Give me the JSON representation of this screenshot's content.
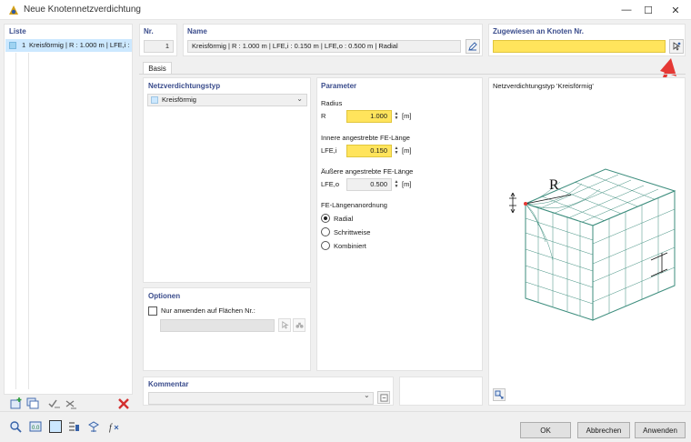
{
  "window": {
    "title": "Neue Knotennetzverdichtung",
    "minimize_icon": "minimize-icon",
    "maximize_icon": "maximize-icon",
    "close_icon": "close-icon"
  },
  "list": {
    "header": "Liste",
    "items": [
      {
        "number": "1",
        "label": "Kreisförmig | R : 1.000 m | LFE,i : 0.1"
      }
    ],
    "toolbar_icons": [
      "new-icon",
      "copy-icon",
      "check-all-icon",
      "uncheck-all-icon",
      "delete-icon"
    ]
  },
  "number": {
    "label": "Nr.",
    "value": "1"
  },
  "name": {
    "label": "Name",
    "value": "Kreisförmig | R : 1.000 m | LFE,i : 0.150 m | LFE,o : 0.500 m | Radial",
    "edit_icon": "edit-icon"
  },
  "assigned": {
    "label": "Zugewiesen an Knoten Nr.",
    "value": "",
    "pick_icon": "pick-node-icon"
  },
  "tabs": [
    {
      "label": "Basis"
    }
  ],
  "type": {
    "header": "Netzverdichtungstyp",
    "selected": "Kreisförmig"
  },
  "options": {
    "header": "Optionen",
    "apply_label": "Nur anwenden auf Flächen Nr.:",
    "apply_checked": false
  },
  "params": {
    "header": "Parameter",
    "radius": {
      "title": "Radius",
      "symbol": "R",
      "value": "1.000",
      "unit": "[m]"
    },
    "inner": {
      "title": "Innere angestrebte FE-Länge",
      "symbol": "LFE,i",
      "value": "0.150",
      "unit": "[m]"
    },
    "outer": {
      "title": "Äußere angestrebte FE-Länge",
      "symbol": "LFE,o",
      "value": "0.500",
      "unit": "[m]"
    },
    "arrangement": {
      "title": "FE-Längenanordnung",
      "options": [
        "Radial",
        "Schrittweise",
        "Kombiniert"
      ],
      "selected": "Radial"
    }
  },
  "preview": {
    "title": "Netzverdichtungstyp 'Kreisförmig'",
    "radius_label": "R"
  },
  "comment": {
    "header": "Kommentar",
    "value": ""
  },
  "footer": {
    "ok": "OK",
    "cancel": "Abbrechen",
    "apply": "Anwenden",
    "tool_icons": [
      "search-icon",
      "units-icon",
      "color-icon",
      "view-icon",
      "formula-icon"
    ]
  },
  "colors": {
    "accent": "#3a4c8c",
    "highlight": "#ffe45c",
    "selection": "#cce8ff",
    "arrow": "#e53935",
    "mesh": "#3e8e7e"
  }
}
